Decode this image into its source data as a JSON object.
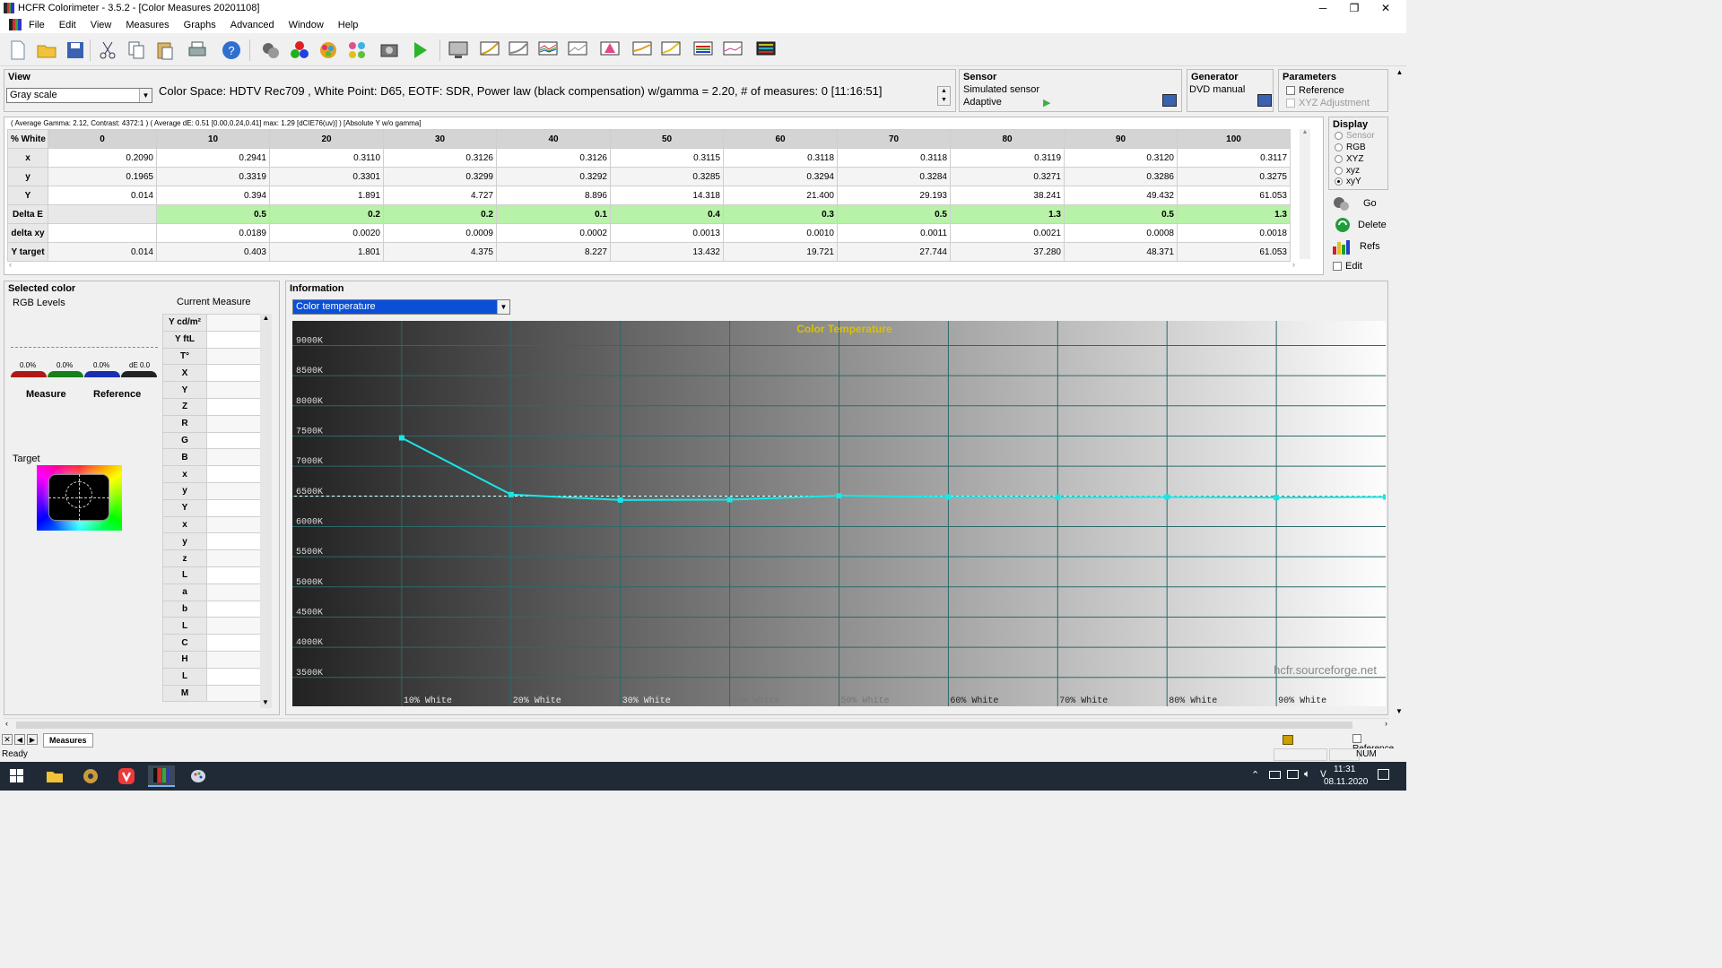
{
  "window": {
    "title": "HCFR Colorimeter - 3.5.2 - [Color Measures 20201108]",
    "minimize": "─",
    "maximize": "❐",
    "close": "✕"
  },
  "menu": [
    "File",
    "Edit",
    "View",
    "Measures",
    "Graphs",
    "Advanced",
    "Window",
    "Help"
  ],
  "mdi_buttons": [
    "–",
    "❐",
    "✕"
  ],
  "view": {
    "header": "View",
    "mode": "Gray scale",
    "info_line": "Color Space: HDTV Rec709 , White Point: D65, EOTF:  SDR, Power law (black compensation) w/gamma = 2.20, # of measures: 0 [11:16:51]"
  },
  "sensor": {
    "header": "Sensor",
    "name": "Simulated sensor",
    "mode": "Adaptive"
  },
  "generator": {
    "header": "Generator",
    "name": "DVD manual"
  },
  "parameters": {
    "header": "Parameters",
    "reference": "Reference",
    "xyz_adjustment": "XYZ Adjustment"
  },
  "stats_line": "( Average Gamma: 2.12, Contrast: 4372:1 ) ( Average dE: 0.51 [0.00,0.24,0.41] max: 1.29 [dCIE76(uv)] ) [Absolute Y w/o gamma]",
  "table": {
    "corner": "% White",
    "columns": [
      "0",
      "10",
      "20",
      "30",
      "40",
      "50",
      "60",
      "70",
      "80",
      "90",
      "100"
    ],
    "rows": [
      {
        "label": "x",
        "values": [
          "0.2090",
          "0.2941",
          "0.3110",
          "0.3126",
          "0.3126",
          "0.3115",
          "0.3118",
          "0.3118",
          "0.3119",
          "0.3120",
          "0.3117"
        ]
      },
      {
        "label": "y",
        "values": [
          "0.1965",
          "0.3319",
          "0.3301",
          "0.3299",
          "0.3292",
          "0.3285",
          "0.3294",
          "0.3284",
          "0.3271",
          "0.3286",
          "0.3275"
        ]
      },
      {
        "label": "Y",
        "values": [
          "0.014",
          "0.394",
          "1.891",
          "4.727",
          "8.896",
          "14.318",
          "21.400",
          "29.193",
          "38.241",
          "49.432",
          "61.053"
        ]
      },
      {
        "label": "Delta E",
        "values": [
          "",
          "0.5",
          "0.2",
          "0.2",
          "0.1",
          "0.4",
          "0.3",
          "0.5",
          "1.3",
          "0.5",
          "1.3"
        ]
      },
      {
        "label": "delta xy",
        "values": [
          "",
          "0.0189",
          "0.0020",
          "0.0009",
          "0.0002",
          "0.0013",
          "0.0010",
          "0.0011",
          "0.0021",
          "0.0008",
          "0.0018"
        ]
      },
      {
        "label": "Y target",
        "values": [
          "0.014",
          "0.403",
          "1.801",
          "4.375",
          "8.227",
          "13.432",
          "19.721",
          "27.744",
          "37.280",
          "48.371",
          "61.053"
        ]
      }
    ]
  },
  "display": {
    "header": "Display",
    "options": [
      "Sensor",
      "RGB",
      "XYZ",
      "xyz",
      "xyY"
    ],
    "selected": "xyY",
    "go": "Go",
    "delete": "Delete",
    "refs": "Refs",
    "edit": "Edit"
  },
  "selected_color": {
    "header": "Selected color",
    "rgb_levels": "RGB Levels",
    "current_measure": "Current Measure",
    "levels": [
      "0.0%",
      "0.0%",
      "0.0%",
      "dE 0.0"
    ],
    "measure": "Measure",
    "reference": "Reference",
    "target": "Target",
    "side_labels": [
      "Y cd/m²",
      "Y ftL",
      "T°",
      "X",
      "Y",
      "Z",
      "R",
      "G",
      "B",
      "x",
      "y",
      "Y",
      "x",
      "y",
      "z",
      "L",
      "a",
      "b",
      "L",
      "C",
      "H",
      "L",
      "M"
    ]
  },
  "information": {
    "header": "Information",
    "graph_select": "Color temperature"
  },
  "chart_data": {
    "type": "line",
    "title": "Color Temperature",
    "ylabel": "",
    "xlabel": "",
    "y_ticks": [
      "9000K",
      "8500K",
      "8000K",
      "7500K",
      "7000K",
      "6500K",
      "6000K",
      "5500K",
      "5000K",
      "4500K",
      "4000K",
      "3500K"
    ],
    "x_labels": [
      "10% White",
      "20% White",
      "30% White",
      "40% White",
      "50% White",
      "60% White",
      "70% White",
      "80% White",
      "90% White"
    ],
    "ylim": [
      3200,
      9200
    ],
    "reference_line": 6504,
    "series": [
      {
        "values": [
          7470,
          6530,
          6440,
          6445,
          6510,
          6490,
          6485,
          6490,
          6480,
          6490
        ]
      }
    ],
    "watermark": "hcfr.sourceforge.net",
    "line_color": "#19e6e6",
    "title_color": "#d8c200"
  },
  "tabs": {
    "active": "Measures",
    "reference": "Reference"
  },
  "status": {
    "text": "Ready",
    "num": "NUM"
  },
  "taskbar": {
    "time": "11:31",
    "date": "08.11.2020"
  }
}
